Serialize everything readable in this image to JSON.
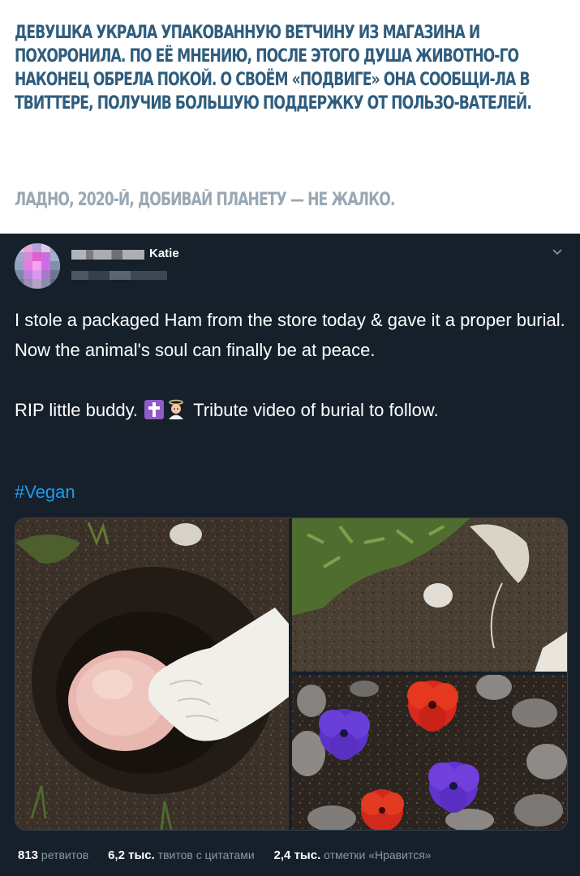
{
  "caption": {
    "main": "Девушка украла упакованную ветчину из магазина и похоронила. По её мнению, после этого душа животно-го наконец обрела покой. О своём «подвиге» она сообщи-ла в Твиттере, получив большую поддержку от пользо-вателей.",
    "sub": "Ладно, 2020-й, добивай планету — не жалко."
  },
  "tweet": {
    "display_name": "Katie",
    "lines": [
      "I stole a packaged Ham from the store today & gave it a proper burial.",
      "Now the animal's soul can finally be at peace.",
      "RIP little buddy.",
      "Tribute video of burial to follow."
    ],
    "hashtag": "#Vegan",
    "emoji": [
      "cross-icon",
      "angel-icon"
    ],
    "media": [
      "photo-ham-in-hole",
      "photo-grave-mound",
      "photo-flowers-and-stones"
    ]
  },
  "stats": {
    "retweets_count": "813",
    "retweets_label": "ретвитов",
    "quotes_count": "6,2 тыс.",
    "quotes_label": "твитов с цитатами",
    "likes_count": "2,4 тыс.",
    "likes_label": "отметки «Нравится»"
  },
  "colors": {
    "caption_text": "#2f5d7e",
    "caption_sub": "#9aa8b4",
    "tweet_bg": "#15202b",
    "hashtag": "#1d9bf0",
    "muted": "#8899a6"
  }
}
